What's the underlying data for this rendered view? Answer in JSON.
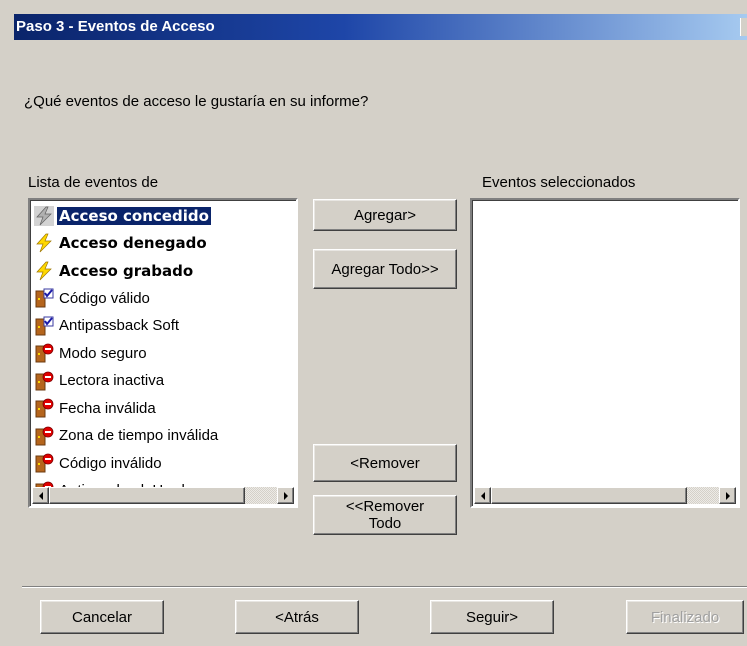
{
  "window": {
    "title": "Paso 3 - Eventos de Acceso"
  },
  "question": "¿Qué eventos de acceso le gustaría en su informe?",
  "available": {
    "label": "Lista de eventos de",
    "items": [
      {
        "label": "Acceso concedido",
        "icon": "bolt-gray-icon",
        "bold": true,
        "selected": true
      },
      {
        "label": "Acceso denegado",
        "icon": "bolt-yellow-icon",
        "bold": true,
        "selected": false
      },
      {
        "label": "Acceso grabado",
        "icon": "bolt-yellow-icon",
        "bold": true,
        "selected": false
      },
      {
        "label": "Código válido",
        "icon": "door-check-icon",
        "bold": false,
        "selected": false
      },
      {
        "label": "Antipassback Soft",
        "icon": "door-check-icon",
        "bold": false,
        "selected": false
      },
      {
        "label": "Modo seguro",
        "icon": "door-denied-icon",
        "bold": false,
        "selected": false
      },
      {
        "label": "Lectora inactiva",
        "icon": "door-denied-icon",
        "bold": false,
        "selected": false
      },
      {
        "label": "Fecha inválida",
        "icon": "door-denied-icon",
        "bold": false,
        "selected": false
      },
      {
        "label": "Zona de tiempo inválida",
        "icon": "door-denied-icon",
        "bold": false,
        "selected": false
      },
      {
        "label": "Código inválido",
        "icon": "door-denied-icon",
        "bold": false,
        "selected": false
      },
      {
        "label": "Antipassback Hard",
        "icon": "door-denied-icon",
        "bold": false,
        "selected": false
      }
    ]
  },
  "selected": {
    "label": "Eventos seleccionados",
    "items": []
  },
  "buttons": {
    "add": "Agregar>",
    "add_all": "Agregar Todo>>",
    "remove": "<Remover",
    "remove_all_line1": "<<Remover",
    "remove_all_line2": "Todo",
    "cancel": "Cancelar",
    "back": "<Atrás",
    "next": "Seguir>",
    "finish": "Finalizado"
  },
  "colors": {
    "face": "#d4d0c8",
    "selection": "#0a246a",
    "title_start": "#0a246a",
    "title_end": "#a6caf0"
  }
}
